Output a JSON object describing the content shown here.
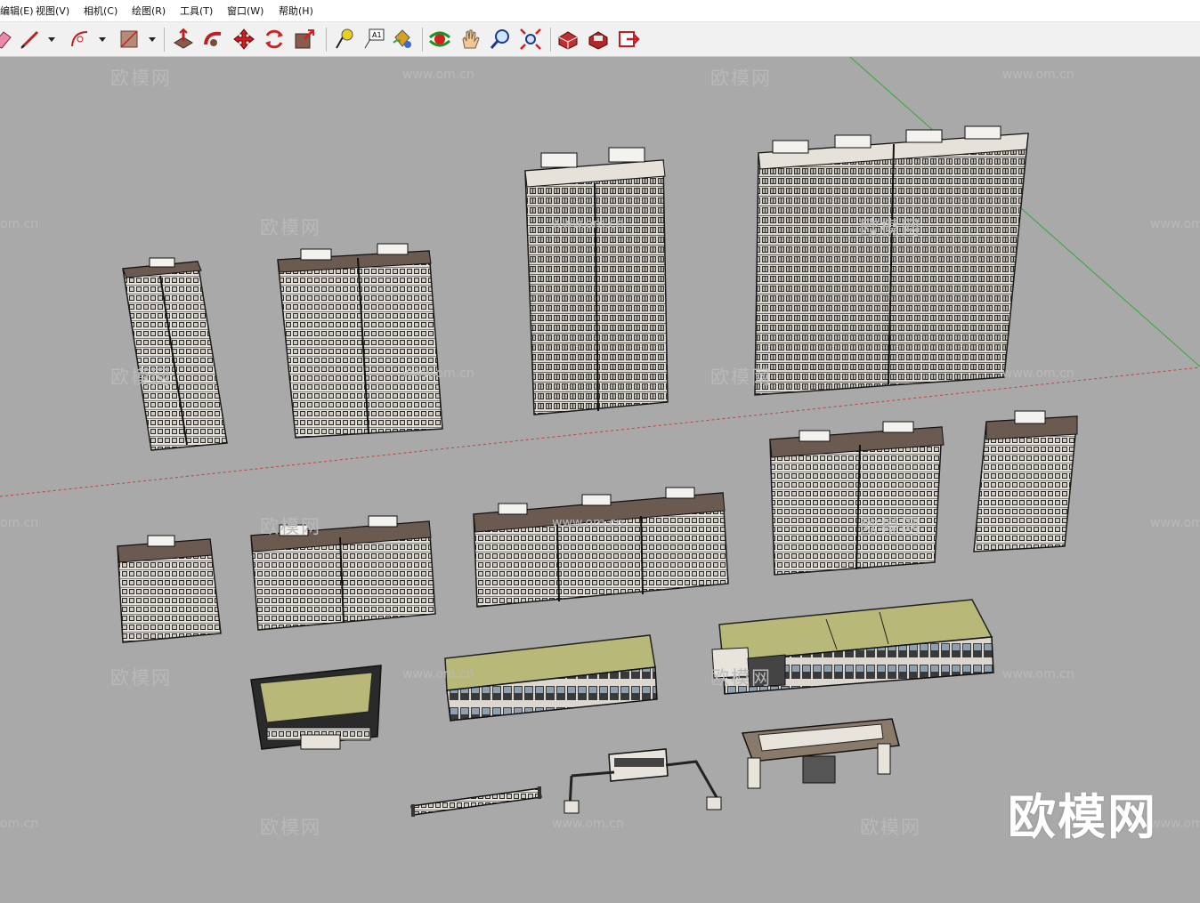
{
  "app": {
    "name": "SketchUp",
    "accent_color": "#c00000"
  },
  "menubar": {
    "items": [
      {
        "label": "编辑(E)"
      },
      {
        "label": "视图(V)"
      },
      {
        "label": "相机(C)"
      },
      {
        "label": "绘图(R)"
      },
      {
        "label": "工具(T)"
      },
      {
        "label": "窗口(W)"
      },
      {
        "label": "帮助(H)"
      }
    ]
  },
  "toolbar": {
    "tools": [
      {
        "icon": "eraser-icon"
      },
      {
        "icon": "pencil-line-icon"
      },
      {
        "icon": "arc-icon"
      },
      {
        "icon": "rectangle-icon"
      },
      {
        "icon": "push-pull-icon"
      },
      {
        "icon": "follow-me-icon"
      },
      {
        "icon": "move-icon"
      },
      {
        "icon": "rotate-icon"
      },
      {
        "icon": "scale-icon"
      },
      {
        "icon": "tape-measure-icon"
      },
      {
        "icon": "text-icon",
        "label": "A1"
      },
      {
        "icon": "paint-bucket-icon"
      },
      {
        "icon": "orbit-icon"
      },
      {
        "icon": "pan-icon"
      },
      {
        "icon": "zoom-icon"
      },
      {
        "icon": "zoom-extents-icon"
      },
      {
        "icon": "3d-warehouse-icon"
      },
      {
        "icon": "extension-warehouse-icon"
      },
      {
        "icon": "send-to-layout-icon"
      }
    ]
  },
  "viewport": {
    "background_color": "#a9a9a9",
    "axes": {
      "green": "#33aa33",
      "red": "#c04040"
    },
    "buildings": {
      "count": 18,
      "types": [
        "high-rise tower",
        "mid-rise block",
        "podium retail",
        "clubhouse",
        "entrance gate",
        "fence wall"
      ],
      "roof_color": "#b8b878",
      "wall_color": "#e8e4dc",
      "frame_color": "#2a2a2a"
    }
  },
  "watermarks": {
    "text": "欧模网",
    "url": "www.om.cn",
    "url_edge": "om.cn",
    "brand_logo": "欧模网"
  }
}
